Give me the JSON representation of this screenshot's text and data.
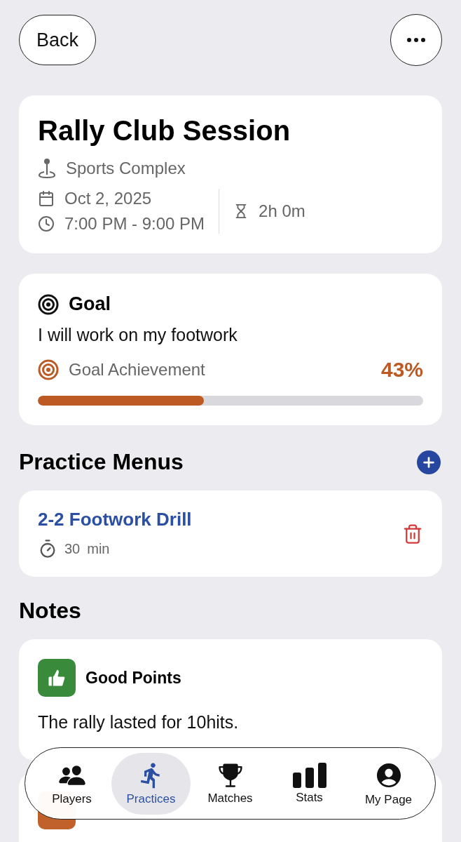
{
  "header": {
    "back": "Back"
  },
  "session": {
    "title": "Rally Club Session",
    "location": "Sports Complex",
    "date": "Oct 2, 2025",
    "time": "7:00 PM - 9:00 PM",
    "duration": "2h 0m"
  },
  "goal": {
    "heading": "Goal",
    "text": "I will work on my footwork",
    "achievement_label": "Goal Achievement",
    "achievement_value": "43%",
    "level": 0.43
  },
  "practice_menus": {
    "heading": "Practice Menus",
    "items": [
      {
        "title": "2-2 Footwork Drill",
        "minutes": "30",
        "unit": "min"
      }
    ]
  },
  "notes": {
    "heading": "Notes",
    "items": [
      {
        "kind": "good",
        "title": "Good Points",
        "text": "The rally lasted for 10hits."
      },
      {
        "kind": "bad"
      }
    ]
  },
  "tabs": [
    {
      "kind": "players",
      "label": "Players",
      "selected": false
    },
    {
      "kind": "practices",
      "label": "Practices",
      "selected": true
    },
    {
      "kind": "matches",
      "label": "Matches",
      "selected": false
    },
    {
      "kind": "stats",
      "label": "Stats",
      "selected": false
    },
    {
      "kind": "mypage",
      "label": "My Page",
      "selected": false
    }
  ]
}
